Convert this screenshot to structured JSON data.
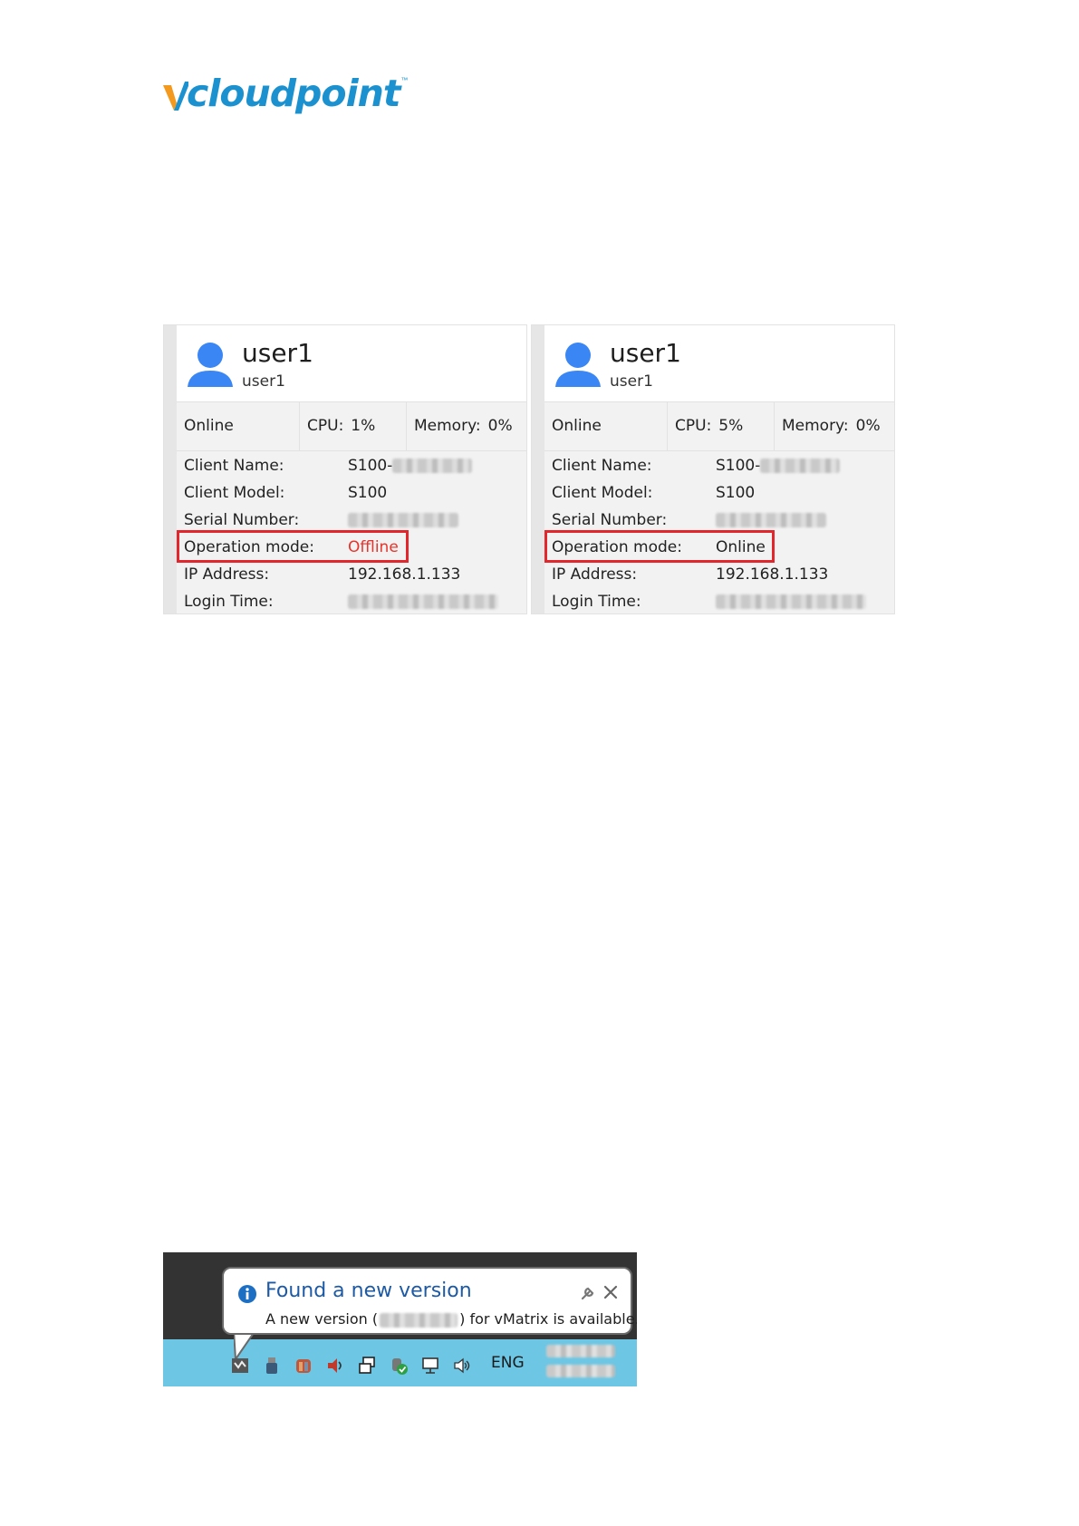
{
  "logo": {
    "text": "cloudpoint",
    "trademark": "™",
    "brand_color": "#1b92cf",
    "accent_color": "#f39a1e"
  },
  "cards": [
    {
      "user_name": "user1",
      "user_subname": "user1",
      "status": "Online",
      "cpu_label": "CPU:",
      "cpu_value": "1%",
      "memory_label": "Memory:",
      "memory_value": "0%",
      "client_name_label": "Client Name:",
      "client_name_value": "S100-",
      "client_model_label": "Client Model:",
      "client_model_value": "S100",
      "serial_number_label": "Serial Number:",
      "operation_mode_label": "Operation mode:",
      "operation_mode_value": "Offline",
      "ip_address_label": "IP Address:",
      "ip_address_value": "192.168.1.133",
      "login_time_label": "Login Time:"
    },
    {
      "user_name": "user1",
      "user_subname": "user1",
      "status": "Online",
      "cpu_label": "CPU:",
      "cpu_value": "5%",
      "memory_label": "Memory:",
      "memory_value": "0%",
      "client_name_label": "Client Name:",
      "client_name_value": "S100-",
      "client_model_label": "Client Model:",
      "client_model_value": "S100",
      "serial_number_label": "Serial Number:",
      "operation_mode_label": "Operation mode:",
      "operation_mode_value": "Online",
      "ip_address_label": "IP Address:",
      "ip_address_value": "192.168.1.133",
      "login_time_label": "Login Time:"
    }
  ],
  "notification": {
    "title": "Found a new version",
    "text_before": "A new version (",
    "text_after": ") for vMatrix is available."
  },
  "taskbar": {
    "language": "ENG",
    "icons": [
      "vmatrix-icon",
      "usb-drive-icon",
      "security-icon",
      "volume-icon",
      "network-icon",
      "shield-check-icon",
      "monitor-network-icon",
      "speaker-icon"
    ]
  },
  "colors": {
    "highlight": "#e3262b",
    "offline": "#e8332a",
    "taskbar": "#6cc6e4",
    "notification_title": "#1d5aa6"
  }
}
